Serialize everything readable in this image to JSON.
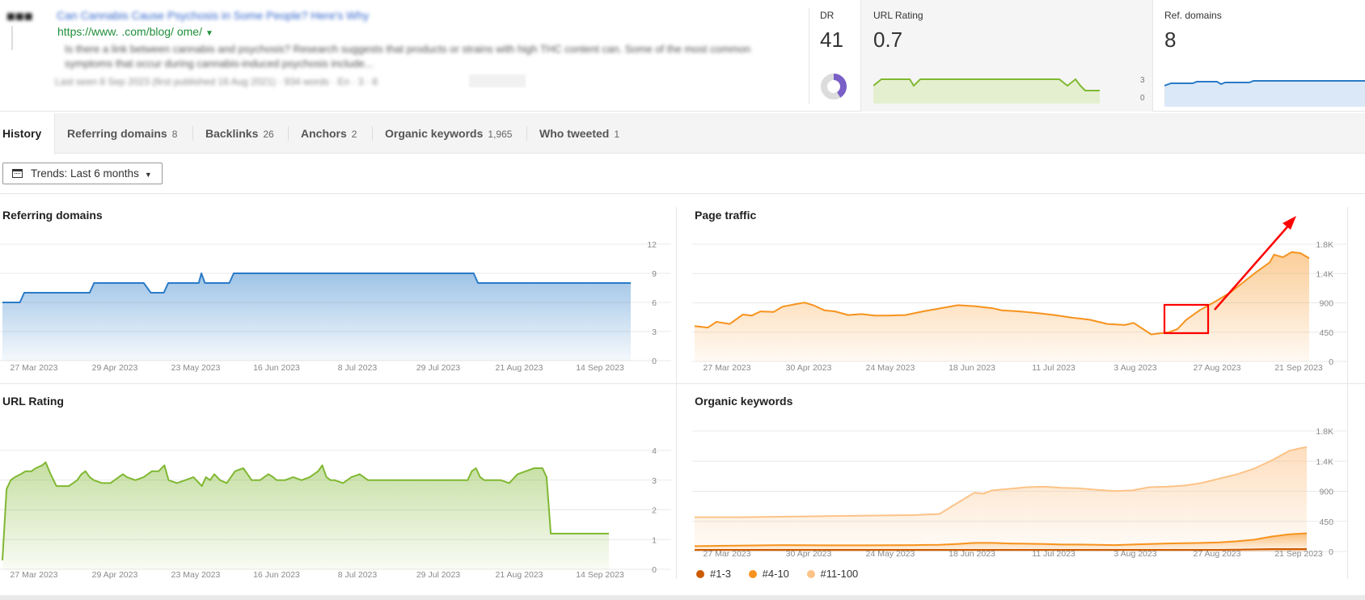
{
  "header": {
    "page_title_blurred": "Can Cannabis Cause Psychosis in Some People? Here's Why",
    "url": "https://www.         .com/blog/                  ome/",
    "description_blurred": "Is there a link between cannabis and psychosis? Research suggests that products or strains with high THC content can. Some of the most common symptoms that occur during cannabis-induced psychosis include...",
    "meta_blurred": "Last seen 8 Sep 2023 (first published 16 Aug 2021) · 934 words · En · 3 · 8",
    "dr": {
      "label": "DR",
      "value": "41"
    },
    "url_rating": {
      "label": "URL Rating",
      "value": "0.7",
      "axis": [
        "3",
        "0"
      ]
    },
    "ref_domains": {
      "label": "Ref. domains",
      "value": "8"
    }
  },
  "tabs": [
    {
      "label": "History",
      "count": "",
      "active": true
    },
    {
      "label": "Referring domains",
      "count": "8"
    },
    {
      "label": "Backlinks",
      "count": "26"
    },
    {
      "label": "Anchors",
      "count": "2"
    },
    {
      "label": "Organic keywords",
      "count": "1,965"
    },
    {
      "label": "Who tweeted",
      "count": "1"
    }
  ],
  "trends": {
    "label": "Trends: Last 6 months"
  },
  "panels": {
    "referring_domains": "Referring domains",
    "page_traffic": "Page traffic",
    "url_rating": "URL Rating",
    "organic_keywords": "Organic keywords"
  },
  "legend": [
    {
      "label": "#1-3",
      "color": "#cc5a00"
    },
    {
      "label": "#4-10",
      "color": "#f7931e"
    },
    {
      "label": "#11-100",
      "color": "#fcc388"
    }
  ],
  "colors": {
    "blue_line": "#2a7bc8",
    "orange_line": "#f7931e",
    "green_line": "#80b832",
    "annotation_red": "#ff0000"
  },
  "chart_data": [
    {
      "id": "referring_domains",
      "type": "area",
      "title": "Referring domains",
      "x_ticks": [
        "27 Mar 2023",
        "29 Apr 2023",
        "23 May 2023",
        "16 Jun 2023",
        "8 Jul 2023",
        "29 Jul 2023",
        "21 Aug 2023",
        "14 Sep 2023"
      ],
      "y_ticks": [
        "12",
        "9",
        "6",
        "3",
        "0"
      ],
      "ylim": [
        0,
        12
      ],
      "x": [
        0,
        20,
        25,
        100,
        105,
        162,
        170,
        185,
        190,
        225,
        228,
        232,
        260,
        265,
        540,
        545,
        720
      ],
      "values": [
        6,
        6,
        7,
        7,
        8,
        8,
        7,
        7,
        8,
        8,
        9,
        8,
        8,
        9,
        9,
        8,
        8
      ],
      "xlim": [
        0,
        720
      ],
      "color": "#2a7bc8"
    },
    {
      "id": "page_traffic",
      "type": "area",
      "title": "Page traffic",
      "x_ticks": [
        "27 Mar 2023",
        "30 Apr 2023",
        "24 May 2023",
        "18 Jun 2023",
        "11 Jul 2023",
        "3 Aug 2023",
        "27 Aug 2023",
        "21 Sep 2023"
      ],
      "y_ticks": [
        "1.8K",
        "1.4K",
        "900",
        "450",
        "0"
      ],
      "ylim": [
        0,
        2250
      ],
      "x": [
        0,
        15,
        25,
        40,
        55,
        65,
        75,
        90,
        100,
        115,
        125,
        135,
        148,
        160,
        175,
        190,
        205,
        220,
        240,
        260,
        300,
        320,
        340,
        350,
        370,
        390,
        410,
        430,
        450,
        470,
        490,
        500,
        520,
        540,
        550,
        560,
        575,
        590,
        610,
        625,
        640,
        655,
        660,
        670,
        680,
        690,
        700
      ],
      "values": [
        680,
        650,
        760,
        720,
        900,
        880,
        960,
        950,
        1050,
        1100,
        1130,
        1080,
        980,
        960,
        890,
        910,
        880,
        880,
        890,
        960,
        1080,
        1060,
        1020,
        980,
        960,
        930,
        890,
        840,
        800,
        720,
        700,
        740,
        520,
        560,
        620,
        800,
        980,
        1120,
        1320,
        1520,
        1720,
        1900,
        2050,
        2000,
        2100,
        2080,
        1980
      ],
      "xlim": [
        0,
        700
      ],
      "color": "#f7931e"
    },
    {
      "id": "url_rating",
      "type": "area",
      "title": "URL Rating",
      "x_ticks": [
        "27 Mar 2023",
        "29 Apr 2023",
        "23 May 2023",
        "16 Jun 2023",
        "8 Jul 2023",
        "29 Jul 2023",
        "21 Aug 2023",
        "14 Sep 2023"
      ],
      "y_ticks": [
        "4",
        "3",
        "2",
        "1",
        "0"
      ],
      "ylim": [
        0,
        4
      ],
      "x": [
        0,
        5,
        10,
        15,
        22,
        28,
        35,
        40,
        48,
        52,
        58,
        65,
        80,
        90,
        95,
        100,
        105,
        110,
        120,
        130,
        140,
        145,
        150,
        160,
        170,
        180,
        188,
        195,
        200,
        210,
        220,
        230,
        240,
        245,
        250,
        255,
        262,
        270,
        280,
        290,
        300,
        310,
        320,
        326,
        330,
        340,
        350,
        360,
        370,
        380,
        385,
        390,
        395,
        400,
        410,
        420,
        430,
        440,
        450,
        560,
        565,
        570,
        575,
        580,
        600,
        610,
        620,
        630,
        640,
        650,
        655,
        660,
        666,
        670,
        730
      ],
      "values": [
        0.3,
        2.7,
        3.0,
        3.1,
        3.2,
        3.3,
        3.3,
        3.4,
        3.5,
        3.6,
        3.2,
        2.8,
        2.8,
        3.0,
        3.2,
        3.3,
        3.1,
        3.0,
        2.9,
        2.9,
        3.1,
        3.2,
        3.1,
        3.0,
        3.1,
        3.3,
        3.3,
        3.5,
        3.0,
        2.9,
        3.0,
        3.1,
        2.8,
        3.1,
        3.0,
        3.2,
        3.0,
        2.9,
        3.3,
        3.4,
        3.0,
        3.0,
        3.2,
        3.1,
        3.0,
        3.0,
        3.1,
        3.0,
        3.1,
        3.3,
        3.5,
        3.1,
        3.0,
        3.0,
        2.9,
        3.1,
        3.2,
        3.0,
        3.0,
        3.0,
        3.3,
        3.4,
        3.1,
        3.0,
        3.0,
        2.9,
        3.2,
        3.3,
        3.4,
        3.4,
        3.1,
        1.2,
        1.2,
        1.2,
        1.2
      ],
      "xlim": [
        0,
        730
      ],
      "color": "#80b832"
    },
    {
      "id": "organic_keywords",
      "type": "area",
      "title": "Organic keywords",
      "x_ticks": [
        "27 Mar 2023",
        "30 Apr 2023",
        "24 May 2023",
        "18 Jun 2023",
        "11 Jul 2023",
        "3 Aug 2023",
        "27 Aug 2023",
        "21 Sep 2023"
      ],
      "y_ticks": [
        "1.8K",
        "1.4K",
        "900",
        "450",
        "0"
      ],
      "ylim": [
        0,
        2250
      ],
      "x": [
        0,
        50,
        100,
        150,
        200,
        250,
        280,
        300,
        320,
        330,
        340,
        360,
        380,
        400,
        420,
        440,
        460,
        480,
        500,
        520,
        540,
        560,
        580,
        600,
        620,
        640,
        660,
        680,
        690,
        700
      ],
      "series": [
        {
          "name": "#11-100",
          "color": "#fcc388",
          "values": [
            640,
            640,
            650,
            660,
            670,
            680,
            700,
            900,
            1100,
            1080,
            1140,
            1170,
            1200,
            1210,
            1190,
            1180,
            1150,
            1130,
            1140,
            1200,
            1210,
            1230,
            1280,
            1360,
            1440,
            1550,
            1700,
            1880,
            1920,
            1950
          ]
        },
        {
          "name": "#4-10",
          "color": "#f7931e",
          "values": [
            100,
            110,
            120,
            115,
            115,
            120,
            125,
            140,
            160,
            160,
            160,
            150,
            145,
            140,
            130,
            130,
            125,
            120,
            130,
            140,
            150,
            155,
            160,
            170,
            190,
            220,
            280,
            320,
            330,
            340
          ]
        },
        {
          "name": "#1-3",
          "color": "#cc5a00",
          "values": [
            30,
            30,
            30,
            30,
            30,
            30,
            30,
            30,
            30,
            30,
            30,
            30,
            30,
            30,
            30,
            30,
            30,
            30,
            30,
            30,
            30,
            30,
            30,
            30,
            35,
            40,
            45,
            45,
            45,
            45
          ]
        }
      ]
    }
  ]
}
